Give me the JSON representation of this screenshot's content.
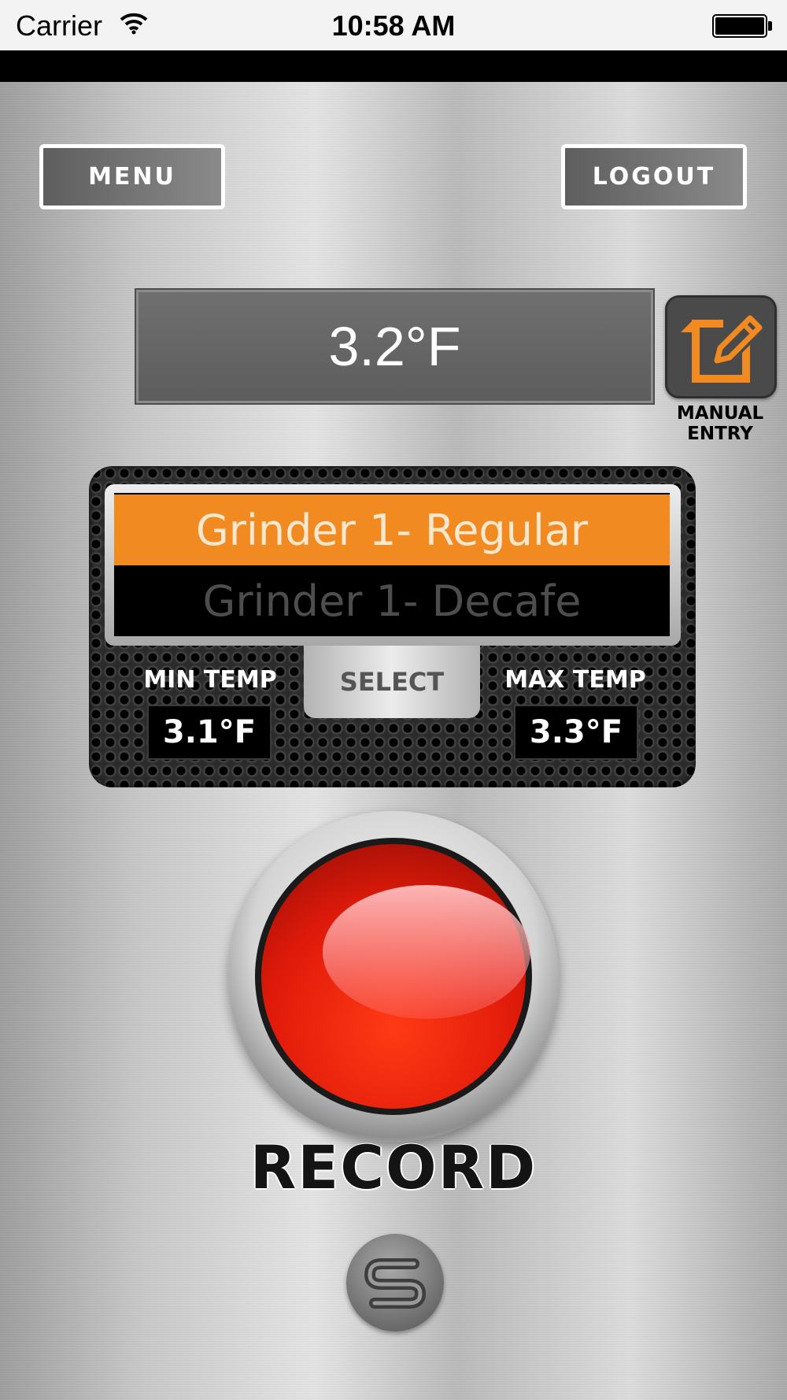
{
  "status_bar": {
    "carrier": "Carrier",
    "time": "10:58 AM",
    "wifi_icon": "wifi-icon",
    "battery_icon": "battery-icon"
  },
  "header": {
    "menu_label": "MENU",
    "logout_label": "LOGOUT"
  },
  "reading": {
    "current_temp": "3.2°F"
  },
  "manual_entry": {
    "icon": "pencil-note-icon",
    "label_line1": "MANUAL",
    "label_line2": "ENTRY",
    "accent_color": "#f08a21"
  },
  "picker": {
    "selected_item": "Grinder 1- Regular",
    "next_item": "Grinder 1- Decafe",
    "select_label": "SELECT",
    "selected_color": "#f08a21"
  },
  "limits": {
    "min_label": "MIN TEMP",
    "min_value": "3.1°F",
    "max_label": "MAX TEMP",
    "max_value": "3.3°F"
  },
  "record": {
    "label": "RECORD",
    "button_color": "#e01a0a"
  },
  "footer": {
    "logo_icon": "brand-s-logo-icon"
  }
}
